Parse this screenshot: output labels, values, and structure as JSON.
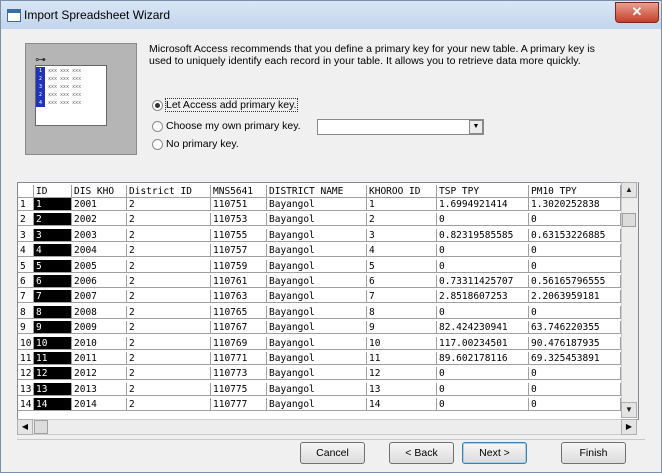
{
  "window": {
    "title": "Import Spreadsheet Wizard",
    "close_glyph": "✕"
  },
  "illustration": {
    "key_glyph": "⊶",
    "rows": [
      {
        "num": "1",
        "text": "xxx xxx xxx"
      },
      {
        "num": "2",
        "text": "xxx xxx xxx"
      },
      {
        "num": "3",
        "text": "xxx xxx xxx"
      },
      {
        "num": "2",
        "text": "xxx xxx xxx"
      },
      {
        "num": "4",
        "text": "xxx xxx xxx"
      }
    ]
  },
  "intro_text": "Microsoft Access recommends that you define a primary key for your new table. A primary key is used to uniquely identify each record in your table. It allows you to retrieve data more quickly.",
  "options": {
    "let_access": "Let Access add primary key.",
    "choose_own": "Choose my own primary key.",
    "no_key": "No primary key.",
    "selected": "let_access",
    "key_field_value": ""
  },
  "grid": {
    "headers": [
      "ID",
      "DIS KHO",
      "District ID",
      "MNS5641",
      "DISTRICT NAME",
      "KHOROO ID",
      "TSP TPY",
      "PM10 TPY"
    ],
    "rows": [
      [
        "1",
        "1",
        "2001",
        "2",
        "110751",
        "Bayangol",
        "1",
        "1.6994921414",
        "1.3020252838"
      ],
      [
        "2",
        "2",
        "2002",
        "2",
        "110753",
        "Bayangol",
        "2",
        "0",
        "0"
      ],
      [
        "3",
        "3",
        "2003",
        "2",
        "110755",
        "Bayangol",
        "3",
        "0.82319585585",
        "0.63153226885"
      ],
      [
        "4",
        "4",
        "2004",
        "2",
        "110757",
        "Bayangol",
        "4",
        "0",
        "0"
      ],
      [
        "5",
        "5",
        "2005",
        "2",
        "110759",
        "Bayangol",
        "5",
        "0",
        "0"
      ],
      [
        "6",
        "6",
        "2006",
        "2",
        "110761",
        "Bayangol",
        "6",
        "0.73311425707",
        "0.56165796555"
      ],
      [
        "7",
        "7",
        "2007",
        "2",
        "110763",
        "Bayangol",
        "7",
        "2.8518607253",
        "2.2063959181"
      ],
      [
        "8",
        "8",
        "2008",
        "2",
        "110765",
        "Bayangol",
        "8",
        "0",
        "0"
      ],
      [
        "9",
        "9",
        "2009",
        "2",
        "110767",
        "Bayangol",
        "9",
        "82.424230941",
        "63.746220355"
      ],
      [
        "10",
        "10",
        "2010",
        "2",
        "110769",
        "Bayangol",
        "10",
        "117.00234501",
        "90.476187935"
      ],
      [
        "11",
        "11",
        "2011",
        "2",
        "110771",
        "Bayangol",
        "11",
        "89.602178116",
        "69.325453891"
      ],
      [
        "12",
        "12",
        "2012",
        "2",
        "110773",
        "Bayangol",
        "12",
        "0",
        "0"
      ],
      [
        "13",
        "13",
        "2013",
        "2",
        "110775",
        "Bayangol",
        "13",
        "0",
        "0"
      ],
      [
        "14",
        "14",
        "2014",
        "2",
        "110777",
        "Bayangol",
        "14",
        "0",
        "0"
      ]
    ]
  },
  "scroll": {
    "up": "▲",
    "down": "▼",
    "left": "◀",
    "right": "▶"
  },
  "buttons": {
    "cancel": "Cancel",
    "back": "< Back",
    "next": "Next >",
    "finish": "Finish"
  },
  "colors": {
    "id_column_bg": "#000000",
    "illustration_bg": "#b5b5b5",
    "sheet_number_bg": "#2233bb"
  }
}
